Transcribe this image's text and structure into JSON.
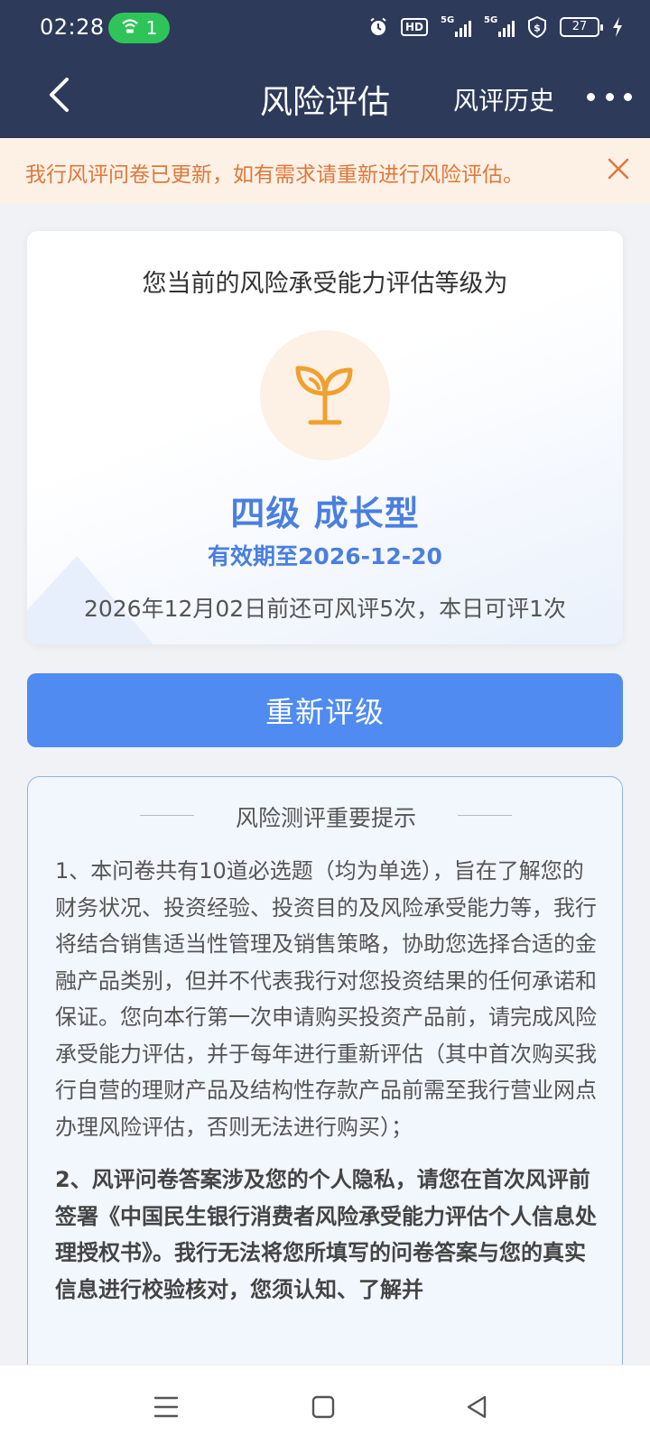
{
  "status_bar": {
    "time": "02:28",
    "hotspot_count": "1",
    "hd_label": "HD",
    "network_1": "5G",
    "network_2": "5G",
    "battery": "27"
  },
  "nav": {
    "title": "风险评估",
    "history_label": "风评历史"
  },
  "notice": {
    "text": "我行风评问卷已更新，如有需求请重新进行风险评估。"
  },
  "result": {
    "heading": "您当前的风险承受能力评估等级为",
    "icon": "sprout-icon",
    "level": "四级 成长型",
    "valid_until": "有效期至2026-12-20",
    "remaining": "2026年12月02日前还可风评5次，本日可评1次"
  },
  "actions": {
    "reassess_label": "重新评级"
  },
  "tips": {
    "title": "风险测评重要提示",
    "items": [
      "1、本问卷共有10道必选题（均为单选），旨在了解您的财务状况、投资经验、投资目的及风险承受能力等，我行将结合销售适当性管理及销售策略，协助您选择合适的金融产品类别，但并不代表我行对您投资结果的任何承诺和保证。您向本行第一次申请购买投资产品前，请完成风险承受能力评估，并于每年进行重新评估（其中首次购买我行自营的理财产品及结构性存款产品前需至我行营业网点办理风险评估，否则无法进行购买）；",
      "2、风评问卷答案涉及您的个人隐私，请您在首次风评前签署《中国民生银行消费者风险承受能力评估个人信息处理授权书》。我行无法将您所填写的问卷答案与您的真实信息进行校验核对，您须认知、了解并"
    ]
  },
  "colors": {
    "header_bg": "#2e3a5a",
    "accent_blue": "#4a7fe0",
    "button_blue": "#4f8bf0",
    "notice_text": "#e0773a",
    "icon_orange": "#f0a030"
  }
}
